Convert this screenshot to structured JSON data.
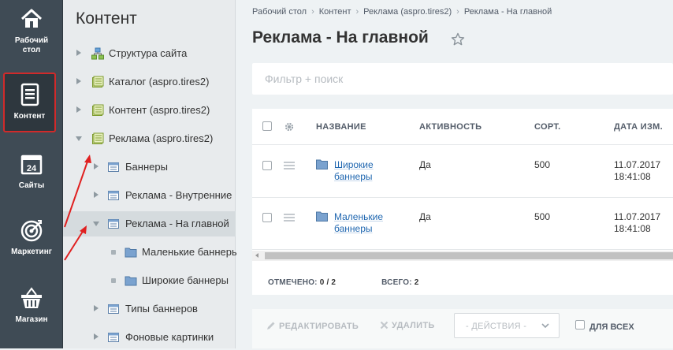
{
  "rail": {
    "items": [
      {
        "label_1": "Рабочий",
        "label_2": "стол",
        "icon": "home-icon"
      },
      {
        "label_1": "Контент",
        "icon": "document-icon",
        "active": true
      },
      {
        "label_1": "Сайты",
        "icon": "calendar-icon",
        "badge": "24"
      },
      {
        "label_1": "Маркетинг",
        "icon": "target-icon"
      },
      {
        "label_1": "Магазин",
        "icon": "basket-icon"
      }
    ]
  },
  "tree": {
    "title": "Контент",
    "items": [
      {
        "label": "Структура сайта"
      },
      {
        "label": "Каталог (aspro.tires2)"
      },
      {
        "label": "Контент (aspro.tires2)"
      },
      {
        "label": "Реклама (aspro.tires2)"
      },
      {
        "label": "Баннеры"
      },
      {
        "label": "Реклама - Внутренние"
      },
      {
        "label": "Реклама - На главной"
      },
      {
        "label": "Маленькие баннеры"
      },
      {
        "label": "Широкие баннеры"
      },
      {
        "label": "Типы баннеров"
      },
      {
        "label": "Фоновые картинки"
      }
    ]
  },
  "breadcrumbs": [
    "Рабочий стол",
    "Контент",
    "Реклама (aspro.tires2)",
    "Реклама - На главной"
  ],
  "page_title": "Реклама - На главной",
  "filter": {
    "placeholder": "Фильтр + поиск"
  },
  "grid": {
    "columns": {
      "name": "НАЗВАНИЕ",
      "activity": "АКТИВНОСТЬ",
      "sort": "СОРТ.",
      "date": "ДАТА ИЗМ."
    },
    "rows": [
      {
        "name_1": "Широкие",
        "name_2": "баннеры",
        "activity": "Да",
        "sort": "500",
        "date_1": "11.07.2017",
        "date_2": "18:41:08"
      },
      {
        "name_1": "Маленькие",
        "name_2": "баннеры",
        "activity": "Да",
        "sort": "500",
        "date_1": "11.07.2017",
        "date_2": "18:41:08"
      }
    ],
    "summary": {
      "checked_label": "ОТМЕЧЕНО:",
      "checked_value": "0 / 2",
      "total_label": "ВСЕГО:",
      "total_value": "2"
    }
  },
  "actions": {
    "edit": "РЕДАКТИРОВАТЬ",
    "delete": "УДАЛИТЬ",
    "select_value": "- ДЕЙСТВИЯ -",
    "for_all": "ДЛЯ ВСЕХ"
  },
  "colors": {
    "accent_red": "#d12a2a",
    "rail_bg": "#3f4b55",
    "link": "#2067b0"
  }
}
